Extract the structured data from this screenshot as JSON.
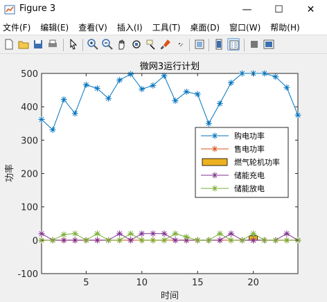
{
  "window": {
    "title": "Figure 3",
    "min_glyph": "—",
    "max_glyph": "☐",
    "close_glyph": "✕"
  },
  "menu": {
    "items": [
      "文件(F)",
      "编辑(E)",
      "查看(V)",
      "插入(I)",
      "工具(T)",
      "桌面(D)",
      "窗口(W)",
      "帮助(H)"
    ]
  },
  "toolbar": {
    "icons": [
      "new-figure-icon",
      "open-file-icon",
      "save-icon",
      "print-icon",
      "pointer-icon",
      "zoom-in-icon",
      "zoom-out-icon",
      "pan-icon",
      "rotate-3d-icon",
      "data-cursor-icon",
      "brush-icon",
      "link-icon",
      "colorbar-icon",
      "legend-icon",
      "hide-plot-tools-icon",
      "show-plot-tools-icon"
    ]
  },
  "colors": {
    "blue": "#0072BD",
    "orange": "#D95319",
    "yellow": "#EDB120",
    "purple": "#7E2F8E",
    "green": "#77AC30",
    "figure_bg": "#f0f0f0"
  },
  "chart_data": {
    "type": "line",
    "title": "微网3运行计划",
    "xlabel": "时间",
    "ylabel": "功率",
    "xlim": [
      1,
      24
    ],
    "ylim": [
      -100,
      500
    ],
    "xticks": [
      5,
      10,
      15,
      20
    ],
    "yticks": [
      -100,
      0,
      100,
      200,
      300,
      400,
      500
    ],
    "grid": false,
    "legend_location": "east",
    "x": [
      1,
      2,
      3,
      4,
      5,
      6,
      7,
      8,
      9,
      10,
      11,
      12,
      13,
      14,
      15,
      16,
      17,
      18,
      19,
      20,
      21,
      22,
      23,
      24
    ],
    "series": [
      {
        "name": "购电功率",
        "type": "line",
        "marker": "asterisk",
        "color": "#0072BD",
        "values": [
          362,
          331,
          422,
          380,
          466,
          455,
          425,
          480,
          498,
          453,
          464,
          493,
          418,
          445,
          438,
          350,
          410,
          472,
          500,
          500,
          500,
          490,
          458,
          375
        ]
      },
      {
        "name": "售电功率",
        "type": "line",
        "marker": "asterisk",
        "color": "#D95319",
        "values": [
          0,
          0,
          0,
          0,
          0,
          0,
          0,
          0,
          0,
          0,
          0,
          0,
          0,
          0,
          0,
          0,
          0,
          0,
          0,
          0,
          0,
          0,
          0,
          0
        ]
      },
      {
        "name": "燃气轮机功率",
        "type": "bar",
        "color": "#EDB120",
        "values": [
          0,
          0,
          0,
          0,
          0,
          0,
          0,
          0,
          0,
          0,
          0,
          0,
          0,
          0,
          0,
          0,
          0,
          0,
          0,
          13,
          0,
          0,
          0,
          0
        ]
      },
      {
        "name": "储能充电",
        "type": "line",
        "marker": "asterisk",
        "color": "#7E2F8E",
        "values": [
          20,
          0,
          0,
          0,
          0,
          0,
          0,
          20,
          0,
          20,
          20,
          20,
          0,
          0,
          0,
          0,
          0,
          20,
          0,
          0,
          0,
          0,
          20,
          0
        ]
      },
      {
        "name": "储能放电",
        "type": "line",
        "marker": "asterisk",
        "color": "#77AC30",
        "values": [
          0,
          0,
          17,
          20,
          0,
          20,
          0,
          0,
          20,
          0,
          0,
          0,
          20,
          10,
          0,
          0,
          20,
          0,
          0,
          20,
          0,
          0,
          0,
          0
        ]
      }
    ]
  }
}
